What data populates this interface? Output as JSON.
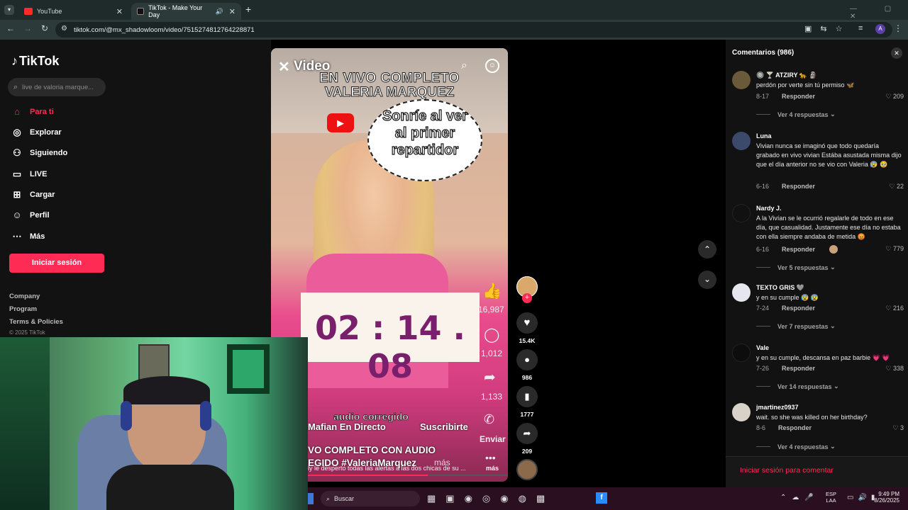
{
  "browser": {
    "tabs": [
      {
        "label": "YouTube"
      },
      {
        "label": "TikTok - Make Your Day"
      }
    ],
    "url": "tiktok.com/@mx_shadowloom/video/7515274812764228871"
  },
  "sidebar": {
    "logo": "TikTok",
    "search_placeholder": "live de valoria marque...",
    "nav": [
      {
        "label": "Para ti",
        "icon": "home-icon"
      },
      {
        "label": "Explorar",
        "icon": "compass-icon"
      },
      {
        "label": "Siguiendo",
        "icon": "following-icon"
      },
      {
        "label": "LIVE",
        "icon": "live-icon"
      },
      {
        "label": "Cargar",
        "icon": "upload-icon"
      },
      {
        "label": "Perfil",
        "icon": "profile-icon"
      },
      {
        "label": "Más",
        "icon": "more-icon"
      }
    ],
    "login_button": "Iniciar sesión",
    "footer": [
      "Company",
      "Program",
      "Terms & Policies",
      "© 2025 TikTok"
    ]
  },
  "video": {
    "header": "Video",
    "banner_line1": "EN VIVO COMPLETO",
    "banner_line2": "VALERIA MARQUEZ",
    "bubble": [
      "Sonríe al ver",
      "al primer",
      "repartidor"
    ],
    "timer": "02 : 14 . 08",
    "audio_label": "audio corregido",
    "channel": "Mafian En Directo",
    "subscribe": "Suscribirte",
    "caption1": "VO COMPLETO CON AUDIO",
    "caption2": "EGIDO #ValeriaMarquez",
    "caption3": "ly le desperto todas las alertas a las dos chicas de su ...",
    "more": "más",
    "more2": "más",
    "overlay_counts": {
      "likes": "16,987",
      "comments": "1,012",
      "shares": "1,133",
      "send": "Enviar"
    }
  },
  "actions": {
    "likes": "15.4K",
    "comments": "986",
    "saves": "1777",
    "shares": "209"
  },
  "comments_panel": {
    "title": "Comentarios (986)",
    "items": [
      {
        "user": "🔘 🍸 ATZIRY 🐆 🗿",
        "text": "perdón por verte sin tú permiso 🦋",
        "date": "8-17",
        "reply": "Responder",
        "likes": "209",
        "more": "Ver 4 respuestas",
        "color": "#6b5a3a"
      },
      {
        "user": "Luna",
        "text": "Vivian nunca se imaginó que todo quedaría grabado en vivo vivian Estába asustada misma dijo que el día anterior no se vio con Valeria 😰 🥹",
        "date": "6-16",
        "reply": "Responder",
        "likes": "22",
        "more": "",
        "color": "#3b4a6b"
      },
      {
        "user": "Nardy J.",
        "text": "A la Vivían se le ocurrió regalarle de todo en ese día, que casualidad. Justamente ese día no estaba con ella siempre andaba de metida 😡",
        "date": "6-16",
        "reply": "Responder",
        "likes": "779",
        "more": "Ver 5 respuestas",
        "color": "#111111"
      },
      {
        "user": "TEXTO GRIS 🩶",
        "text": "y en su cumple 😰 😰",
        "date": "7-24",
        "reply": "Responder",
        "likes": "216",
        "more": "Ver 7 respuestas",
        "color": "#e6e6ee"
      },
      {
        "user": "Vale",
        "text": "y en su cumple, descansa en paz barbie 💗 💗",
        "date": "7-26",
        "reply": "Responder",
        "likes": "338",
        "more": "Ver 14 respuestas",
        "color": "#0d0d0d"
      },
      {
        "user": "jmartinez0937",
        "text": "wait. so she was killed on her birthday?",
        "date": "8-6",
        "reply": "Responder",
        "likes": "3",
        "more": "Ver 4 respuestas",
        "color": "#d9d2c8"
      }
    ],
    "login_prompt": "Iniciar sesión para comentar"
  },
  "taskbar": {
    "search": "Buscar",
    "lang1": "ESP",
    "lang2": "LAA",
    "time": "9:49 PM",
    "date": "8/26/2025"
  },
  "colors": {
    "brand": "#fe2c55",
    "timer": "#7a1f6b"
  }
}
